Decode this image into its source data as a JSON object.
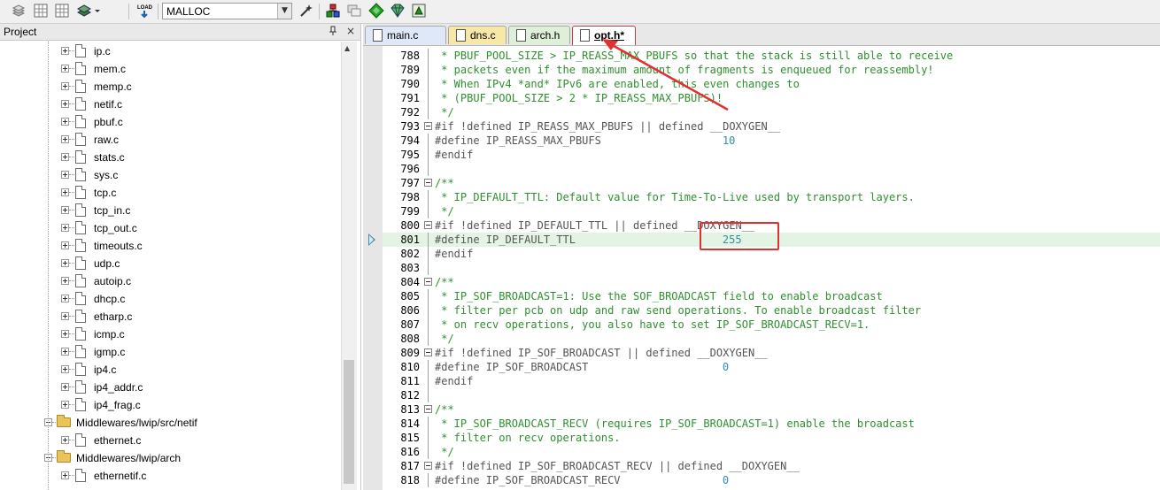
{
  "toolbar": {
    "target": "MALLOC",
    "load_label": "LOAD"
  },
  "project": {
    "title": "Project",
    "pin": "ꟸ",
    "close": "×",
    "items": [
      {
        "label": "ip.c",
        "type": "file"
      },
      {
        "label": "mem.c",
        "type": "file"
      },
      {
        "label": "memp.c",
        "type": "file"
      },
      {
        "label": "netif.c",
        "type": "file"
      },
      {
        "label": "pbuf.c",
        "type": "file"
      },
      {
        "label": "raw.c",
        "type": "file"
      },
      {
        "label": "stats.c",
        "type": "file"
      },
      {
        "label": "sys.c",
        "type": "file"
      },
      {
        "label": "tcp.c",
        "type": "file"
      },
      {
        "label": "tcp_in.c",
        "type": "file"
      },
      {
        "label": "tcp_out.c",
        "type": "file"
      },
      {
        "label": "timeouts.c",
        "type": "file"
      },
      {
        "label": "udp.c",
        "type": "file"
      },
      {
        "label": "autoip.c",
        "type": "file"
      },
      {
        "label": "dhcp.c",
        "type": "file"
      },
      {
        "label": "etharp.c",
        "type": "file"
      },
      {
        "label": "icmp.c",
        "type": "file"
      },
      {
        "label": "igmp.c",
        "type": "file"
      },
      {
        "label": "ip4.c",
        "type": "file"
      },
      {
        "label": "ip4_addr.c",
        "type": "file"
      },
      {
        "label": "ip4_frag.c",
        "type": "file"
      },
      {
        "label": "Middlewares/lwip/src/netif",
        "type": "folder"
      },
      {
        "label": "ethernet.c",
        "type": "file"
      },
      {
        "label": "Middlewares/lwip/arch",
        "type": "folder"
      },
      {
        "label": "ethernetif.c",
        "type": "file"
      }
    ]
  },
  "tabs": [
    {
      "label": "main.c",
      "color": "#dfe8f8"
    },
    {
      "label": "dns.c",
      "color": "#f8e8a8"
    },
    {
      "label": "arch.h",
      "color": "#dff0d8"
    },
    {
      "label": "opt.h*",
      "color": "#f8d8d8",
      "active": true
    }
  ],
  "code": [
    {
      "n": "788",
      "t": " * PBUF_POOL_SIZE > IP_REASS_MAX_PBUFS so that the stack is still able to receive",
      "k": "com"
    },
    {
      "n": "789",
      "t": " * packets even if the maximum amount of fragments is enqueued for reassembly!",
      "k": "com"
    },
    {
      "n": "790",
      "t": " * When IPv4 *and* IPv6 are enabled, this even changes to",
      "k": "com"
    },
    {
      "n": "791",
      "t": " * (PBUF_POOL_SIZE > 2 * IP_REASS_MAX_PBUFS)!",
      "k": "com"
    },
    {
      "n": "792",
      "t": " */",
      "k": "com"
    },
    {
      "n": "793",
      "t": "#if !defined IP_REASS_MAX_PBUFS || defined __DOXYGEN__",
      "k": "pp",
      "fold": true
    },
    {
      "n": "794",
      "t": "#define IP_REASS_MAX_PBUFS",
      "k": "pp",
      "v": "10"
    },
    {
      "n": "795",
      "t": "#endif",
      "k": "pp"
    },
    {
      "n": "796",
      "t": "",
      "k": "pp"
    },
    {
      "n": "797",
      "t": "/**",
      "k": "com",
      "fold": true
    },
    {
      "n": "798",
      "t": " * IP_DEFAULT_TTL: Default value for Time-To-Live used by transport layers.",
      "k": "com"
    },
    {
      "n": "799",
      "t": " */",
      "k": "com"
    },
    {
      "n": "800",
      "t": "#if !defined IP_DEFAULT_TTL || defined __DOXYGEN__",
      "k": "pp",
      "fold": true
    },
    {
      "n": "801",
      "t": "#define IP_DEFAULT_TTL",
      "k": "pp",
      "v": "255",
      "cur": true
    },
    {
      "n": "802",
      "t": "#endif",
      "k": "pp"
    },
    {
      "n": "803",
      "t": "",
      "k": "pp"
    },
    {
      "n": "804",
      "t": "/**",
      "k": "com",
      "fold": true
    },
    {
      "n": "805",
      "t": " * IP_SOF_BROADCAST=1: Use the SOF_BROADCAST field to enable broadcast",
      "k": "com"
    },
    {
      "n": "806",
      "t": " * filter per pcb on udp and raw send operations. To enable broadcast filter",
      "k": "com"
    },
    {
      "n": "807",
      "t": " * on recv operations, you also have to set IP_SOF_BROADCAST_RECV=1.",
      "k": "com"
    },
    {
      "n": "808",
      "t": " */",
      "k": "com"
    },
    {
      "n": "809",
      "t": "#if !defined IP_SOF_BROADCAST || defined __DOXYGEN__",
      "k": "pp",
      "fold": true
    },
    {
      "n": "810",
      "t": "#define IP_SOF_BROADCAST",
      "k": "pp",
      "v": "0"
    },
    {
      "n": "811",
      "t": "#endif",
      "k": "pp"
    },
    {
      "n": "812",
      "t": "",
      "k": "pp"
    },
    {
      "n": "813",
      "t": "/**",
      "k": "com",
      "fold": true
    },
    {
      "n": "814",
      "t": " * IP_SOF_BROADCAST_RECV (requires IP_SOF_BROADCAST=1) enable the broadcast",
      "k": "com"
    },
    {
      "n": "815",
      "t": " * filter on recv operations.",
      "k": "com"
    },
    {
      "n": "816",
      "t": " */",
      "k": "com"
    },
    {
      "n": "817",
      "t": "#if !defined IP_SOF_BROADCAST_RECV || defined __DOXYGEN__",
      "k": "pp",
      "fold": true
    },
    {
      "n": "818",
      "t": "#define IP_SOF_BROADCAST_RECV",
      "k": "pp",
      "v": "0"
    }
  ],
  "colors": {
    "comment": "#2f8f2f",
    "number": "#2f8fa0",
    "current_line": "#e4f4e4",
    "annotation": "#e03030"
  }
}
